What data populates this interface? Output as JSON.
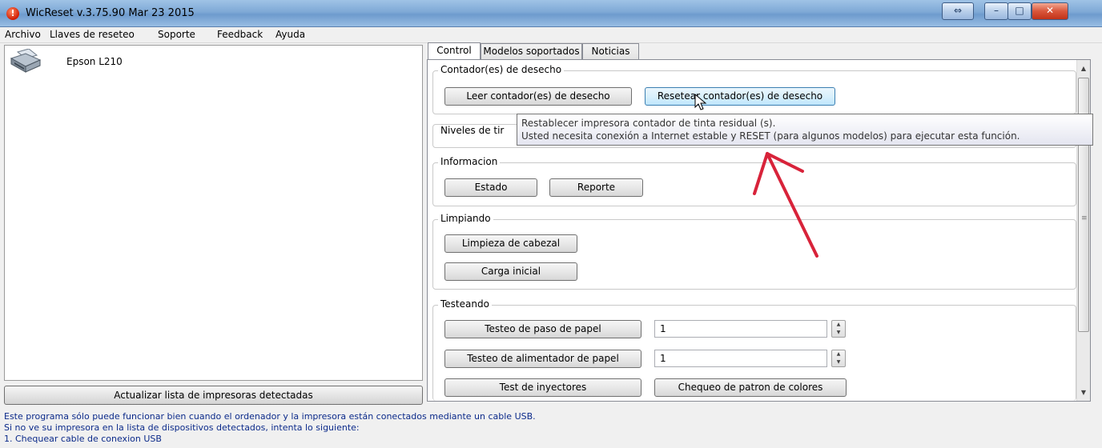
{
  "window": {
    "title": "WicReset v.3.75.90 Mar 23 2015",
    "icon_glyph": "!",
    "controls": {
      "restore_glyph": "⇔",
      "minimize_glyph": "–",
      "maximize_glyph": "□",
      "close_glyph": "✕"
    }
  },
  "menu": [
    "Archivo",
    "Llaves de reseteo",
    "Soporte",
    "Feedback",
    "Ayuda"
  ],
  "printers": [
    {
      "name": "Epson L210",
      "icon": "printer-icon"
    }
  ],
  "left": {
    "update_label": "Actualizar lista de impresoras detectadas"
  },
  "tabs": [
    "Control",
    "Modelos soportados",
    "Noticias"
  ],
  "control": {
    "waste": {
      "title": "Contador(es) de desecho",
      "read_label": "Leer contador(es) de desecho",
      "reset_label": "Resetear contador(es) de desecho"
    },
    "ink": {
      "title": "Niveles de tir"
    },
    "info": {
      "title": "Informacion",
      "status_label": "Estado",
      "report_label": "Reporte"
    },
    "cleaning": {
      "title": "Limpiando",
      "head_label": "Limpieza de cabezal",
      "charge_label": "Carga inicial"
    },
    "testing": {
      "title": "Testeando",
      "paper_feed_label": "Testeo de paso de papel",
      "paper_feed_value": "1",
      "feeder_label": "Testeo de alimentador de papel",
      "feeder_value": "1",
      "nozzle_label": "Test de inyectores",
      "color_label": "Chequeo de patron de colores"
    }
  },
  "tooltip": {
    "line1": "Restablecer impresora contador de tinta residual (s).",
    "line2": "Usted necesita conexión a Internet estable y RESET (para algunos modelos) para ejecutar esta función."
  },
  "info_lines": [
    "Este programa sólo puede funcionar bien cuando el ordenador y la impresora están conectados mediante un cable USB.",
    "Si no ve su impresora en la lista de dispositivos detectados, intenta lo siguiente:",
    "1. Chequear cable de conexion USB"
  ],
  "colors": {
    "annotation_arrow": "#d8233a",
    "info_text": "#0b2a8a"
  }
}
